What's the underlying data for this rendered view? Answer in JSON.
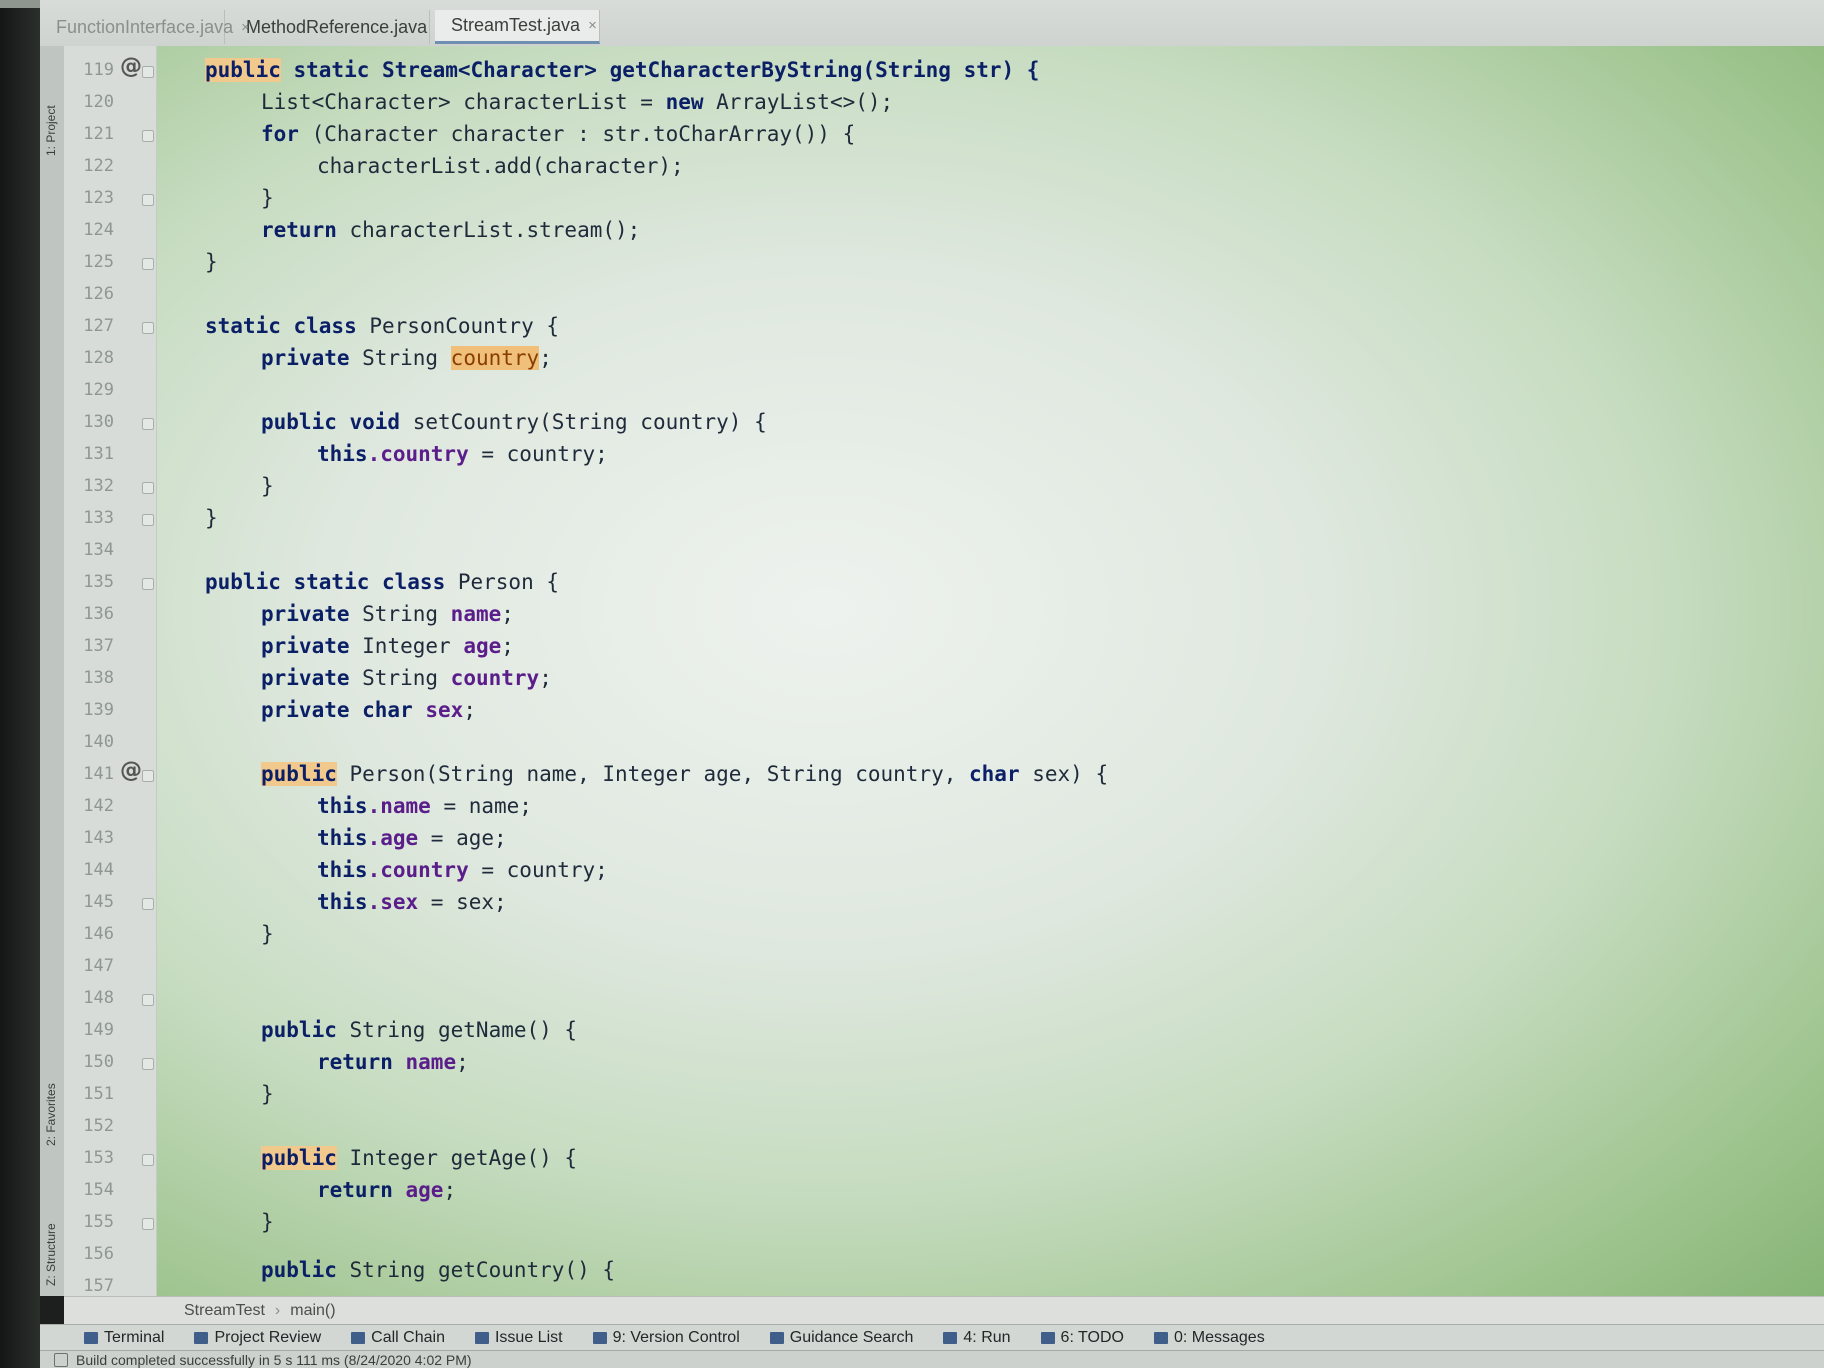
{
  "tabs": [
    {
      "label": "FunctionInterface.java",
      "active": false
    },
    {
      "label": "MethodReference.java",
      "active": false
    },
    {
      "label": "StreamTest.java",
      "active": true
    }
  ],
  "side_labels": {
    "project": "1: Project",
    "favorites": "2: Favorites",
    "structure": "Z: Structure"
  },
  "line_numbers": [
    "119",
    "120",
    "121",
    "122",
    "123",
    "124",
    "125",
    "126",
    "127",
    "128",
    "129",
    "130",
    "131",
    "132",
    "133",
    "134",
    "135",
    "136",
    "137",
    "138",
    "139",
    "140",
    "141",
    "142",
    "143",
    "144",
    "145",
    "146",
    "147",
    "148",
    "149",
    "150",
    "151",
    "152",
    "153",
    "154",
    "155",
    "156",
    "157"
  ],
  "override_marker": "@",
  "code": {
    "l119": {
      "a": "public",
      "b": " static Stream<Character> getCharacterByString(String str) {"
    },
    "l120": {
      "a": "List<Character> characterList = ",
      "kw": "new",
      "b": " ArrayList<>();"
    },
    "l121": {
      "kw": "for",
      "b": " (Character character : str.toCharArray()) {"
    },
    "l122": "characterList.add(character);",
    "l123": "}",
    "l124": {
      "kw": "return",
      "b": " characterList.stream();"
    },
    "l125": "}",
    "l127": {
      "kw": "static class",
      "b": " PersonCountry {"
    },
    "l128": {
      "kw": "private",
      "b": " String ",
      "hl": "country",
      "c": ";"
    },
    "l130": {
      "kw": "public void",
      "b": " setCountry(String country) {"
    },
    "l131": {
      "kw": "this",
      "fld": ".country",
      "b": " = country;"
    },
    "l132": "}",
    "l133": "}",
    "l135": {
      "kw": "public static class",
      "b": " Person {"
    },
    "l136": {
      "kw": "private",
      "b": " String ",
      "fld": "name",
      "c": ";"
    },
    "l137": {
      "kw": "private",
      "b": " Integer ",
      "fld": "age",
      "c": ";"
    },
    "l138": {
      "kw": "private",
      "b": " String ",
      "fld": "country",
      "c": ";"
    },
    "l139": {
      "kw": "private char",
      "b": " ",
      "fld": "sex",
      "c": ";"
    },
    "l141": {
      "a": "public",
      "b": " Person(String name, Integer age, String country, ",
      "kw": "char",
      "c": " sex) {"
    },
    "l142": {
      "kw": "this",
      "fld": ".name",
      "b": " = name;"
    },
    "l143": {
      "kw": "this",
      "fld": ".age",
      "b": " = age;"
    },
    "l144": {
      "kw": "this",
      "fld": ".country",
      "b": " = country;"
    },
    "l145": {
      "kw": "this",
      "fld": ".sex",
      "b": " = sex;"
    },
    "l146": "}",
    "l149": {
      "kw": "public",
      "b": " String getName() {"
    },
    "l150": {
      "kw": "return",
      "b": " ",
      "fld": "name",
      "c": ";"
    },
    "l151": "}",
    "l153": {
      "a": "public",
      "b": " Integer getAge() {"
    },
    "l154": {
      "kw": "return",
      "b": " ",
      "fld": "age",
      "c": ";"
    },
    "l155": "}",
    "l157": {
      "kw": "public",
      "b": " String getCountry() {"
    }
  },
  "breadcrumb": {
    "class": "StreamTest",
    "method": "main()"
  },
  "tool_windows": [
    "Terminal",
    "Project Review",
    "Call Chain",
    "Issue List",
    "9: Version Control",
    "Guidance Search",
    "4: Run",
    "6: TODO",
    "0: Messages"
  ],
  "status": "Build completed successfully in 5 s 111 ms (8/24/2020 4:02 PM)",
  "colors": {
    "keyword": "#0a1f66",
    "field": "#5a1d8a",
    "highlight": "#f2c98d"
  }
}
